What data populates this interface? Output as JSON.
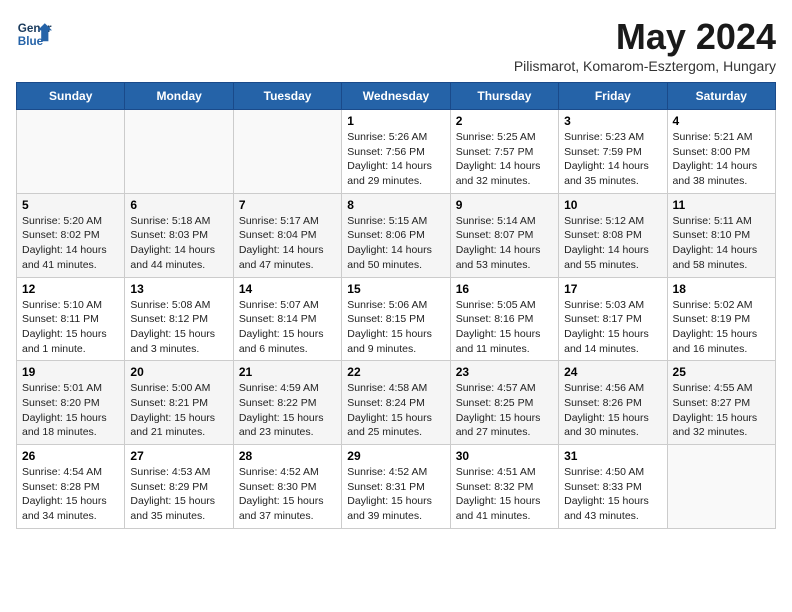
{
  "header": {
    "logo_line1": "General",
    "logo_line2": "Blue",
    "month": "May 2024",
    "location": "Pilismarot, Komarom-Esztergom, Hungary"
  },
  "weekdays": [
    "Sunday",
    "Monday",
    "Tuesday",
    "Wednesday",
    "Thursday",
    "Friday",
    "Saturday"
  ],
  "weeks": [
    [
      {
        "day": "",
        "info": ""
      },
      {
        "day": "",
        "info": ""
      },
      {
        "day": "",
        "info": ""
      },
      {
        "day": "1",
        "info": "Sunrise: 5:26 AM\nSunset: 7:56 PM\nDaylight: 14 hours\nand 29 minutes."
      },
      {
        "day": "2",
        "info": "Sunrise: 5:25 AM\nSunset: 7:57 PM\nDaylight: 14 hours\nand 32 minutes."
      },
      {
        "day": "3",
        "info": "Sunrise: 5:23 AM\nSunset: 7:59 PM\nDaylight: 14 hours\nand 35 minutes."
      },
      {
        "day": "4",
        "info": "Sunrise: 5:21 AM\nSunset: 8:00 PM\nDaylight: 14 hours\nand 38 minutes."
      }
    ],
    [
      {
        "day": "5",
        "info": "Sunrise: 5:20 AM\nSunset: 8:02 PM\nDaylight: 14 hours\nand 41 minutes."
      },
      {
        "day": "6",
        "info": "Sunrise: 5:18 AM\nSunset: 8:03 PM\nDaylight: 14 hours\nand 44 minutes."
      },
      {
        "day": "7",
        "info": "Sunrise: 5:17 AM\nSunset: 8:04 PM\nDaylight: 14 hours\nand 47 minutes."
      },
      {
        "day": "8",
        "info": "Sunrise: 5:15 AM\nSunset: 8:06 PM\nDaylight: 14 hours\nand 50 minutes."
      },
      {
        "day": "9",
        "info": "Sunrise: 5:14 AM\nSunset: 8:07 PM\nDaylight: 14 hours\nand 53 minutes."
      },
      {
        "day": "10",
        "info": "Sunrise: 5:12 AM\nSunset: 8:08 PM\nDaylight: 14 hours\nand 55 minutes."
      },
      {
        "day": "11",
        "info": "Sunrise: 5:11 AM\nSunset: 8:10 PM\nDaylight: 14 hours\nand 58 minutes."
      }
    ],
    [
      {
        "day": "12",
        "info": "Sunrise: 5:10 AM\nSunset: 8:11 PM\nDaylight: 15 hours\nand 1 minute."
      },
      {
        "day": "13",
        "info": "Sunrise: 5:08 AM\nSunset: 8:12 PM\nDaylight: 15 hours\nand 3 minutes."
      },
      {
        "day": "14",
        "info": "Sunrise: 5:07 AM\nSunset: 8:14 PM\nDaylight: 15 hours\nand 6 minutes."
      },
      {
        "day": "15",
        "info": "Sunrise: 5:06 AM\nSunset: 8:15 PM\nDaylight: 15 hours\nand 9 minutes."
      },
      {
        "day": "16",
        "info": "Sunrise: 5:05 AM\nSunset: 8:16 PM\nDaylight: 15 hours\nand 11 minutes."
      },
      {
        "day": "17",
        "info": "Sunrise: 5:03 AM\nSunset: 8:17 PM\nDaylight: 15 hours\nand 14 minutes."
      },
      {
        "day": "18",
        "info": "Sunrise: 5:02 AM\nSunset: 8:19 PM\nDaylight: 15 hours\nand 16 minutes."
      }
    ],
    [
      {
        "day": "19",
        "info": "Sunrise: 5:01 AM\nSunset: 8:20 PM\nDaylight: 15 hours\nand 18 minutes."
      },
      {
        "day": "20",
        "info": "Sunrise: 5:00 AM\nSunset: 8:21 PM\nDaylight: 15 hours\nand 21 minutes."
      },
      {
        "day": "21",
        "info": "Sunrise: 4:59 AM\nSunset: 8:22 PM\nDaylight: 15 hours\nand 23 minutes."
      },
      {
        "day": "22",
        "info": "Sunrise: 4:58 AM\nSunset: 8:24 PM\nDaylight: 15 hours\nand 25 minutes."
      },
      {
        "day": "23",
        "info": "Sunrise: 4:57 AM\nSunset: 8:25 PM\nDaylight: 15 hours\nand 27 minutes."
      },
      {
        "day": "24",
        "info": "Sunrise: 4:56 AM\nSunset: 8:26 PM\nDaylight: 15 hours\nand 30 minutes."
      },
      {
        "day": "25",
        "info": "Sunrise: 4:55 AM\nSunset: 8:27 PM\nDaylight: 15 hours\nand 32 minutes."
      }
    ],
    [
      {
        "day": "26",
        "info": "Sunrise: 4:54 AM\nSunset: 8:28 PM\nDaylight: 15 hours\nand 34 minutes."
      },
      {
        "day": "27",
        "info": "Sunrise: 4:53 AM\nSunset: 8:29 PM\nDaylight: 15 hours\nand 35 minutes."
      },
      {
        "day": "28",
        "info": "Sunrise: 4:52 AM\nSunset: 8:30 PM\nDaylight: 15 hours\nand 37 minutes."
      },
      {
        "day": "29",
        "info": "Sunrise: 4:52 AM\nSunset: 8:31 PM\nDaylight: 15 hours\nand 39 minutes."
      },
      {
        "day": "30",
        "info": "Sunrise: 4:51 AM\nSunset: 8:32 PM\nDaylight: 15 hours\nand 41 minutes."
      },
      {
        "day": "31",
        "info": "Sunrise: 4:50 AM\nSunset: 8:33 PM\nDaylight: 15 hours\nand 43 minutes."
      },
      {
        "day": "",
        "info": ""
      }
    ]
  ]
}
